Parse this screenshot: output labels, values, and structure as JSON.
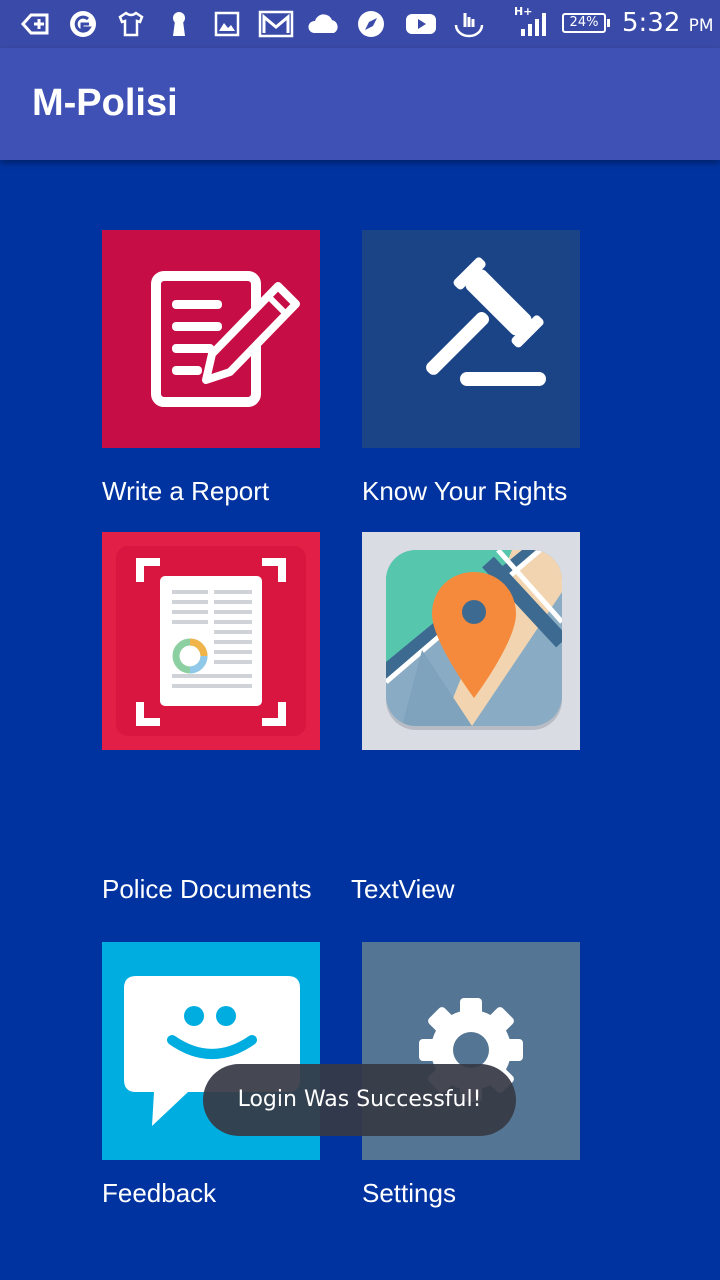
{
  "status_bar": {
    "network": "H+",
    "battery": "24%",
    "time": "5:32",
    "ampm": "PM",
    "icons": [
      "add-box-icon",
      "browser-icon",
      "tshirt-icon",
      "keyhole-icon",
      "gallery-icon",
      "gmail-icon",
      "cloud-icon",
      "compass-icon",
      "youtube-icon",
      "touchpal-icon",
      "signal-icon",
      "battery-icon"
    ]
  },
  "app_bar": {
    "title": "M-Polisi"
  },
  "tiles": [
    {
      "label": "Write a Report",
      "icon": "report-edit-icon",
      "color": "#c70d45"
    },
    {
      "label": "Know Your Rights",
      "icon": "gavel-icon",
      "color": "#1b4487"
    },
    {
      "label": "Police Documents",
      "icon": "document-scan-icon",
      "color": "#e21f47"
    },
    {
      "label": "TextView",
      "icon": "map-pin-icon",
      "color": "#d9dce2"
    },
    {
      "label": "Feedback",
      "icon": "chat-smile-icon",
      "color": "#00ade0"
    },
    {
      "label": "Settings",
      "icon": "gear-icon",
      "color": "#547694"
    }
  ],
  "toast": {
    "message": "Login Was Successful!"
  },
  "colors": {
    "background": "#0033a0",
    "app_bar": "#3f51b5",
    "status_bar": "#3a4aa8"
  }
}
